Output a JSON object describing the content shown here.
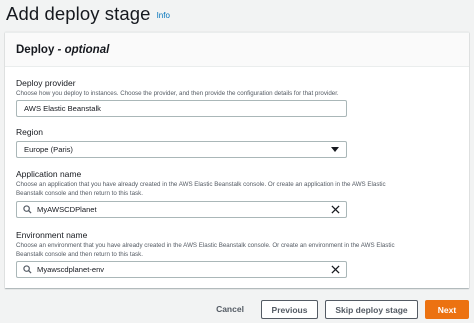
{
  "header": {
    "title": "Add deploy stage",
    "info": "Info"
  },
  "card": {
    "title": "Deploy",
    "title_suffix": "- optional"
  },
  "provider": {
    "label": "Deploy provider",
    "description": "Choose how you deploy to instances. Choose the provider, and then provide the configuration details for that provider.",
    "value": "AWS Elastic Beanstalk"
  },
  "region": {
    "label": "Region",
    "value": "Europe (Paris)"
  },
  "application": {
    "label": "Application name",
    "description_line1": "Choose an application that you have already created in the AWS Elastic Beanstalk console. Or create an application in the AWS Elastic",
    "description_line2": "Beanstalk console and then return to this task.",
    "value": "MyAWSCDPlanet"
  },
  "environment": {
    "label": "Environment name",
    "description_line1": "Choose an environment that you have already created in the AWS Elastic Beanstalk console. Or create an environment in the AWS Elastic",
    "description_line2": "Beanstalk console and then return to this task.",
    "value": "Myawscdplanet-env"
  },
  "footer": {
    "cancel": "Cancel",
    "previous": "Previous",
    "skip": "Skip deploy stage",
    "next": "Next"
  },
  "colors": {
    "primary": "#ec7211",
    "link": "#0073bb",
    "text": "#16191f"
  }
}
